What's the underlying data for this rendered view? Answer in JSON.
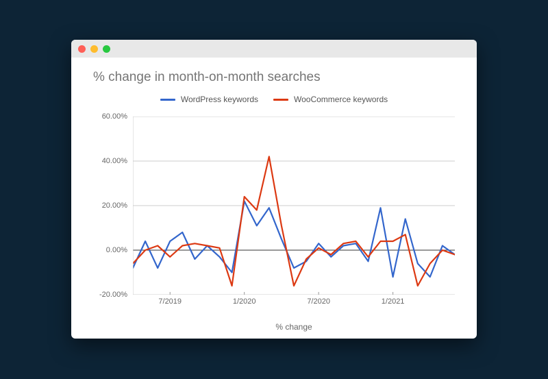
{
  "chart_data": {
    "type": "line",
    "title": "% change in month-on-month searches",
    "xlabel": "% change",
    "ylabel": "",
    "ylim": [
      -20,
      60
    ],
    "yticks": [
      "60.00%",
      "40.00%",
      "20.00%",
      "0.00%",
      "-20.00%"
    ],
    "xticks": [
      "7/2019",
      "1/2020",
      "7/2020",
      "1/2021"
    ],
    "categories": [
      "4/2019",
      "5/2019",
      "6/2019",
      "7/2019",
      "8/2019",
      "9/2019",
      "10/2019",
      "11/2019",
      "12/2019",
      "1/2020",
      "2/2020",
      "3/2020",
      "4/2020",
      "5/2020",
      "6/2020",
      "7/2020",
      "8/2020",
      "9/2020",
      "10/2020",
      "11/2020",
      "12/2020",
      "1/2021",
      "2/2021",
      "3/2021",
      "4/2021",
      "5/2021",
      "6/2021"
    ],
    "series": [
      {
        "name": "WordPress keywords",
        "color": "#3366cc",
        "values": [
          -8,
          4,
          -8,
          4,
          8,
          -4,
          2,
          -3,
          -10,
          22,
          11,
          19,
          5,
          -8,
          -5,
          3,
          -3,
          2,
          3,
          -5,
          19,
          -12,
          14,
          -6,
          -12,
          2,
          -2
        ]
      },
      {
        "name": "WooCommerce keywords",
        "color": "#dc3912",
        "values": [
          -6,
          0,
          2,
          -3,
          2,
          3,
          2,
          1,
          -16,
          24,
          18,
          42,
          11,
          -16,
          -4,
          1,
          -2,
          3,
          4,
          -3,
          4,
          4,
          7,
          -16,
          -6,
          0,
          -2
        ]
      }
    ]
  }
}
